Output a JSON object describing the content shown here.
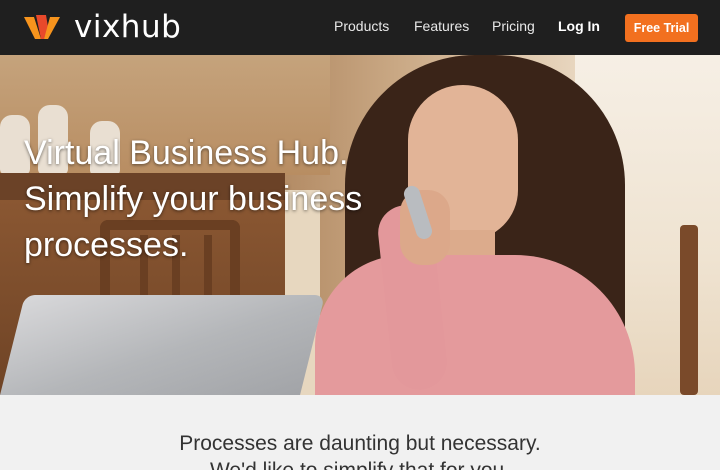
{
  "brand": {
    "name": "vixhub",
    "colors": {
      "accent": "#f2701f",
      "logo_orange": "#f7941d",
      "logo_red": "#e8492b",
      "nav_bg": "#1f1f1f"
    }
  },
  "nav": {
    "links": [
      "Products",
      "Features",
      "Pricing",
      "Log In"
    ],
    "cta": "Free Trial"
  },
  "hero": {
    "headline_lines": [
      "Virtual Business Hub.",
      "Simplify your business",
      "processes."
    ],
    "image": "woman-on-phone-with-laptop"
  },
  "section": {
    "tagline_lines": [
      "Processes are daunting but necessary.",
      "We'd like to simplify that for you."
    ]
  }
}
